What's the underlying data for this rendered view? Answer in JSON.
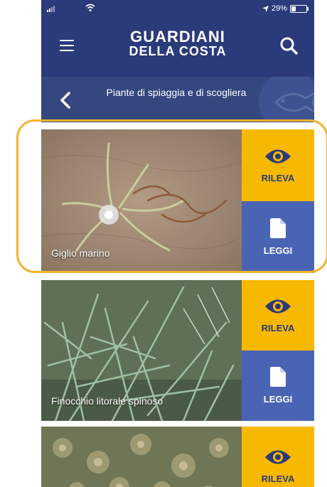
{
  "status_bar": {
    "battery": "29%",
    "battery_level": 0.29
  },
  "header": {
    "logo_line1": "GUARDIANI",
    "logo_line2": "DELLA COSTA",
    "menu_icon": "hamburger-menu-icon",
    "search_icon": "search-icon"
  },
  "subheader": {
    "title": "Piante di spiaggia e di scogliera",
    "back_icon": "chevron-left-icon"
  },
  "items": [
    {
      "name": "Giglio marino",
      "rileva_label": "RILEVA",
      "leggi_label": "LEGGI"
    },
    {
      "name": "Finocchio litorale spinoso",
      "rileva_label": "RILEVA",
      "leggi_label": "LEGGI"
    },
    {
      "name": "",
      "rileva_label": "RILEVA"
    }
  ],
  "colors": {
    "navy": "#2b3a7a",
    "yellow": "#f7b800",
    "blue": "#4a64b4",
    "highlight": "#f2b22c"
  }
}
